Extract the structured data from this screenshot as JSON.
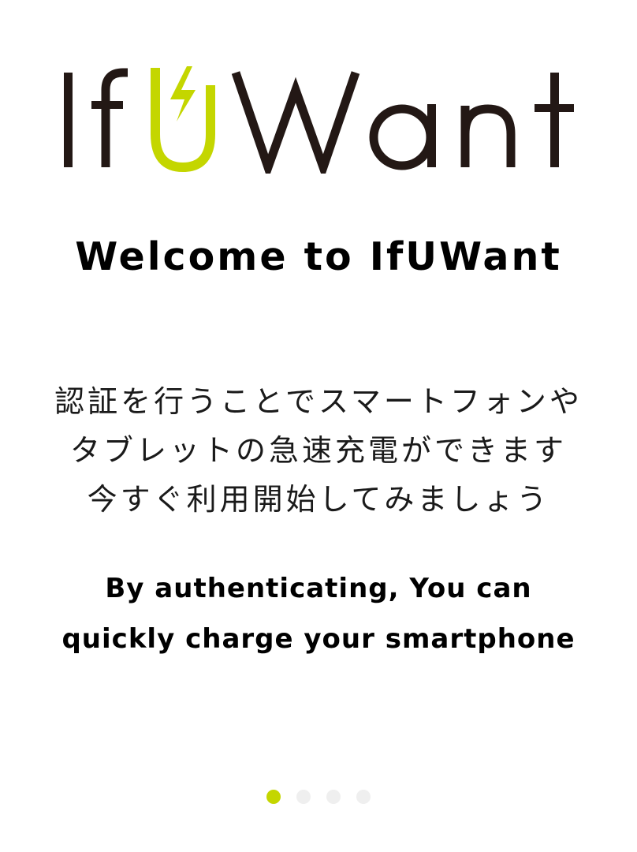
{
  "logo": {
    "text_left": "If",
    "text_u": "U",
    "text_right": "Want",
    "icon": "lightning-bolt-icon",
    "text_color": "#231815",
    "accent_color": "#c4d600"
  },
  "welcome_title": "Welcome to IfUWant",
  "japanese_message": {
    "line1": "認証を行うことでスマートフォンや",
    "line2": "タブレットの急速充電ができます",
    "line3": "今すぐ利用開始してみましょう"
  },
  "english_message": {
    "line1": "By authenticating, You can",
    "line2": "quickly charge your smartphone"
  },
  "pager": {
    "total_pages": 4,
    "current_page": 1,
    "active_color": "#c4d600",
    "inactive_color": "#efefef"
  }
}
